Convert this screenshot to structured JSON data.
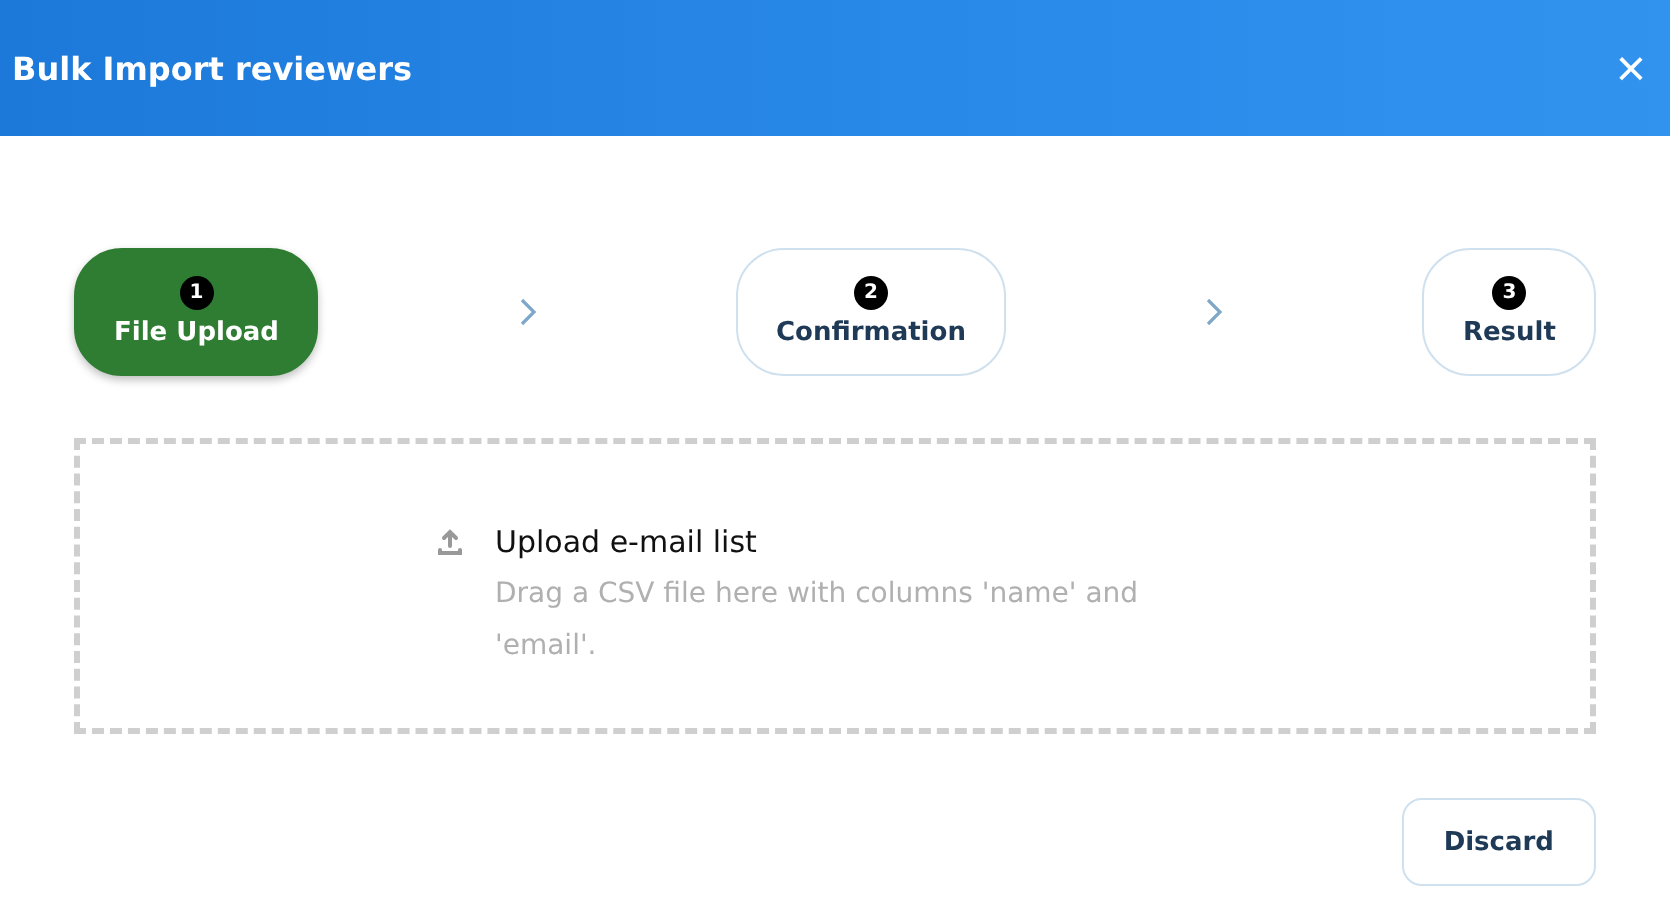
{
  "window": {
    "title": "Bulk Import reviewers",
    "close": "×"
  },
  "steps": [
    {
      "number": "1",
      "label": "File Upload",
      "selected": true
    },
    {
      "number": "2",
      "label": "Confirmation",
      "selected": false
    },
    {
      "number": "3",
      "label": "Result",
      "selected": false
    }
  ],
  "dropzone": {
    "title": "Upload e-mail list",
    "hint": "Drag a CSV file here with columns 'name' and 'email'."
  },
  "buttons": [
    "Discard"
  ]
}
